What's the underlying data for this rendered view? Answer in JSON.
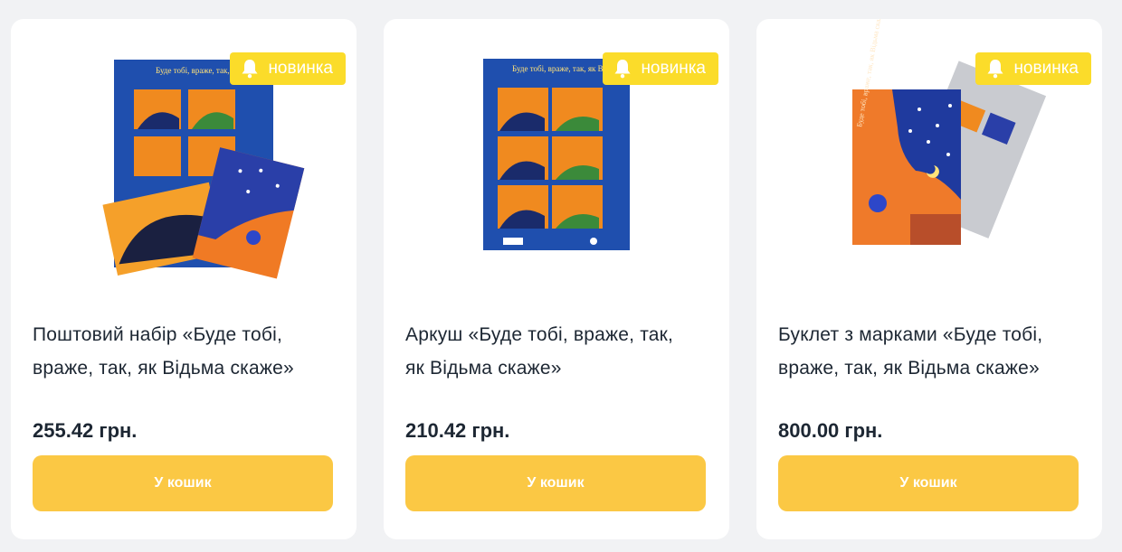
{
  "products": [
    {
      "badge_label": "новинка",
      "title": "Поштовий набір «Буде тобі, враже, так, як Відьма скаже»",
      "price": "255.42 грн.",
      "cart_label": "У кошик",
      "image_lettering": "Буде тобі, враже, так, як Відьма скаже"
    },
    {
      "badge_label": "новинка",
      "title": "Аркуш «Буде тобі, враже, так, як Відьма скаже»",
      "price": "210.42 грн.",
      "cart_label": "У кошик",
      "image_lettering": "Буде тобі, враже, так, як Відьма скаже"
    },
    {
      "badge_label": "новинка",
      "title": "Буклет з марками «Буде тобі, враже, так, як Відьма скаже»",
      "price": "800.00 грн.",
      "cart_label": "У кошик",
      "image_lettering": "Буде тобі, враже, так, як Відьма скаже"
    }
  ],
  "colors": {
    "badge": "#fbdc2a",
    "button": "#fbc844",
    "sheet_blue": "#1f4fae",
    "stamp_orange": "#f08a1f"
  },
  "icons": {
    "badge": "bell-icon"
  }
}
